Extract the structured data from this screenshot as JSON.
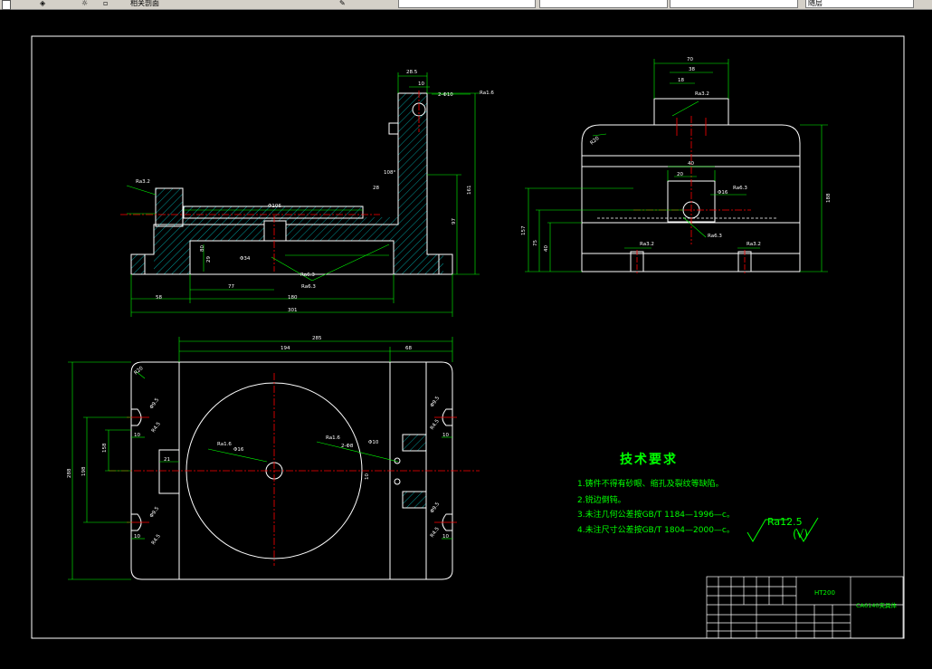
{
  "toolbar": {
    "layer_label": "相关剖面",
    "tabs": [
      "",
      "",
      "",
      ""
    ],
    "right_label": "随层"
  },
  "drawing": {
    "colors": {
      "background": "#000000",
      "outline": "#ffffff",
      "dimension": "#00ff00",
      "center": "#ff0000",
      "hatch": "#00ffff"
    },
    "front_view": {
      "dims": [
        "28.5",
        "10",
        "2-Φ10",
        "Ra1.6",
        "Ra3.2",
        "Φ106",
        "161",
        "97",
        "Ra6.3",
        "Φ34",
        "Ra6.3",
        "58",
        "77",
        "180",
        "301",
        "108°",
        "28",
        "80",
        "29"
      ]
    },
    "side_view": {
      "dims": [
        "70",
        "38",
        "18",
        "Ra3.2",
        "R20",
        "40",
        "20",
        "Φ16",
        "Ra6.3",
        "Ra3.2",
        "Ra3.2",
        "Ra6.3",
        "188",
        "157",
        "75",
        "40"
      ]
    },
    "top_view": {
      "dims": [
        "285",
        "194",
        "68",
        "R20",
        "Φ9.5",
        "R4.5",
        "10",
        "Φ9.5",
        "R4.5",
        "10",
        "158",
        "198",
        "288",
        "21",
        "Ra1.6",
        "Φ16",
        "Ra1.6",
        "2-Φ8",
        "Φ10",
        "10",
        "Φ9.5",
        "R4.5",
        "10",
        "Φ9.5",
        "R4.5",
        "10"
      ]
    },
    "notes": {
      "title": "技术要求",
      "items": [
        "1.铸件不得有砂眼、缩孔及裂纹等缺陷。",
        "2.锐边倒钝。",
        "3.未注几何公差按GB/T 1184—1996—c。",
        "4.未注尺寸公差按GB/T 1804—2000—c。"
      ],
      "roughness": "Ra12.5",
      "roughness_suffix": "(√)"
    },
    "title_block": {
      "material": "HT200",
      "drawing_name": "CA6140夹具体"
    }
  }
}
